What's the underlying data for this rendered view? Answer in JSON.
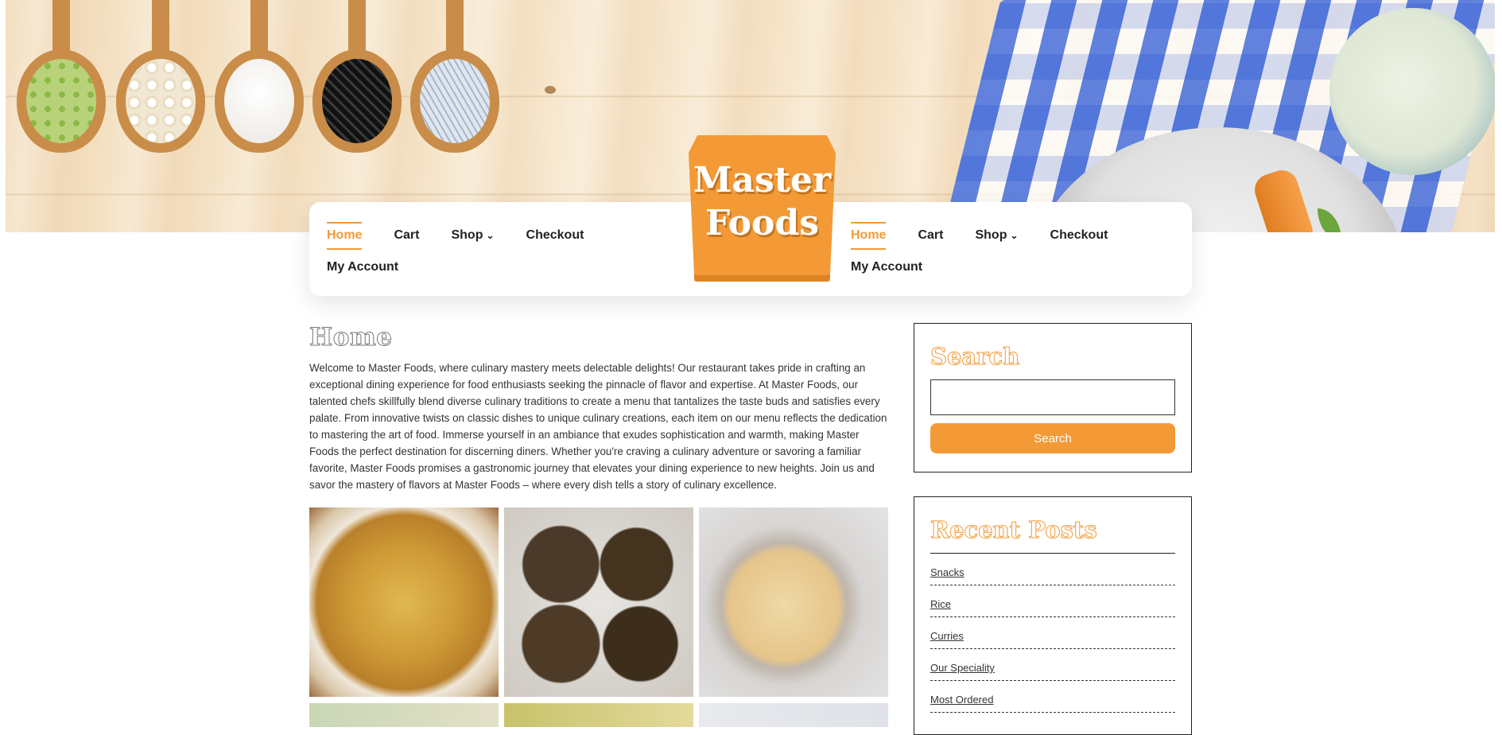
{
  "site": {
    "logo_line1": "Master",
    "logo_line2": "Foods"
  },
  "nav_left": {
    "home": "Home",
    "cart": "Cart",
    "shop": "Shop",
    "checkout": "Checkout",
    "my_account": "My Account"
  },
  "nav_right": {
    "home": "Home",
    "cart": "Cart",
    "shop": "Shop",
    "checkout": "Checkout",
    "my_account": "My Account"
  },
  "main": {
    "title": "Home",
    "intro": "Welcome to Master Foods, where culinary mastery meets delectable delights! Our restaurant takes pride in crafting an exceptional dining experience for food enthusiasts seeking the pinnacle of flavor and expertise. At Master Foods, our talented chefs skillfully blend diverse culinary traditions to create a menu that tantalizes the taste buds and satisfies every palate. From innovative twists on classic dishes to unique culinary creations, each item on our menu reflects the dedication to mastering the art of food. Immerse yourself in an ambiance that exudes sophistication and warmth, making Master Foods the perfect destination for discerning diners. Whether you're craving a culinary adventure or savoring a familiar favorite, Master Foods promises a gastronomic journey that elevates your dining experience to new heights. Join us and savor the mastery of flavors at Master Foods – where every dish tells a story of culinary excellence."
  },
  "search_widget": {
    "title": "Search",
    "input_value": "",
    "button_label": "Search"
  },
  "recent_posts": {
    "title": "Recent Posts",
    "items": [
      "Snacks",
      "Rice",
      "Curries",
      "Our Speciality",
      "Most Ordered"
    ]
  },
  "colors": {
    "accent": "#f39a36",
    "text": "#333333",
    "card_bg": "#ffffff"
  },
  "icons": {
    "shop_dropdown": "chevron-down-icon"
  }
}
